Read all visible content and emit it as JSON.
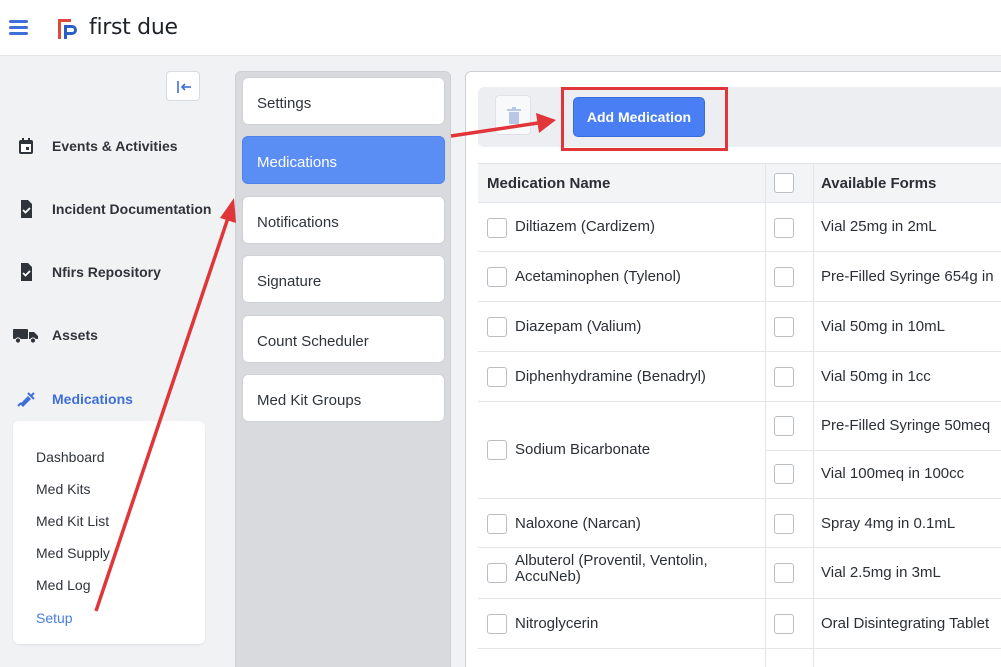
{
  "app": {
    "name": "first due"
  },
  "sidebar": {
    "items": [
      {
        "label": "Events & Activities",
        "icon": "calendar-icon"
      },
      {
        "label": "Incident Documentation",
        "icon": "document-check-icon"
      },
      {
        "label": "Nfirs Repository",
        "icon": "document-check-icon"
      },
      {
        "label": "Assets",
        "icon": "truck-icon"
      },
      {
        "label": "Medications",
        "icon": "syringe-icon",
        "active": true
      }
    ],
    "submenu": [
      "Dashboard",
      "Med Kits",
      "Med Kit List",
      "Med Supply",
      "Med Log",
      "Setup"
    ]
  },
  "settings_menu": {
    "items": [
      "Settings",
      "Medications",
      "Notifications",
      "Signature",
      "Count Scheduler",
      "Med Kit Groups"
    ],
    "active": "Medications"
  },
  "toolbar": {
    "add_label": "Add Medication",
    "trash_icon": "trash-icon"
  },
  "table": {
    "headers": {
      "name": "Medication Name",
      "forms": "Available Forms"
    },
    "rows": [
      {
        "name": "Diltiazem (Cardizem)",
        "forms": [
          "Vial 25mg in 2mL"
        ]
      },
      {
        "name": "Acetaminophen (Tylenol)",
        "forms": [
          "Pre-Filled Syringe 654g in"
        ]
      },
      {
        "name": "Diazepam (Valium)",
        "forms": [
          "Vial 50mg in 10mL"
        ]
      },
      {
        "name": "Diphenhydramine (Benadryl)",
        "forms": [
          "Vial 50mg in 1cc"
        ]
      },
      {
        "name": "Sodium Bicarbonate",
        "forms": [
          "Pre-Filled Syringe 50meq",
          "Vial 100meq in 100cc"
        ]
      },
      {
        "name": "Naloxone (Narcan)",
        "forms": [
          "Spray 4mg in 0.1mL"
        ]
      },
      {
        "name_line1": "Albuterol (Proventil, Ventolin,",
        "name_line2": "AccuNeb)",
        "forms": [
          "Vial 2.5mg in 3mL"
        ]
      },
      {
        "name": "Nitroglycerin",
        "forms": [
          "Oral Disintegrating Tablet"
        ]
      }
    ]
  },
  "colors": {
    "accent": "#4a7ef5",
    "annotation": "#e0363a",
    "active_nav": "#3e6fd8"
  }
}
